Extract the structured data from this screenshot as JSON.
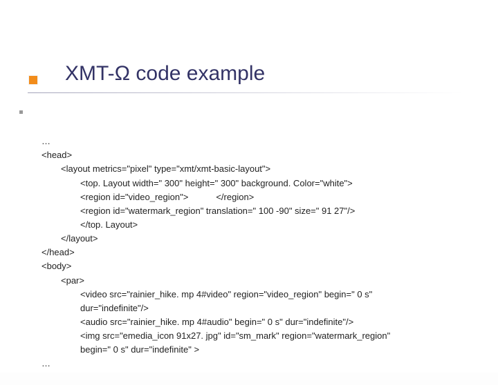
{
  "title": "XMT-Ω code example",
  "code": {
    "l0": "…",
    "l1": "<head>",
    "l2": "<layout metrics=\"pixel\" type=\"xmt/xmt-basic-layout\">",
    "l3": "<top. Layout width=\" 300\" height=\" 300\" background. Color=\"white\">",
    "l4a": "<region id=\"video_region\">",
    "l4b": "</region>",
    "l5": "<region id=\"watermark_region\" translation=\" 100 -90\" size=\" 91 27\"/>",
    "l6": "</top. Layout>",
    "l7": "</layout>",
    "l8": "</head>",
    "l9": "<body>",
    "l10": "<par>",
    "l11": "<video src=\"rainier_hike. mp 4#video\" region=\"video_region\" begin=\" 0 s\"",
    "l12": "dur=\"indefinite\"/>",
    "l13": "<audio src=\"rainier_hike. mp 4#audio\" begin=\" 0 s\" dur=\"indefinite\"/>",
    "l14": "<img src=\"emedia_icon 91x27. jpg\" id=\"sm_mark\" region=\"watermark_region\"",
    "l15": "begin=\" 0 s\" dur=\"indefinite\" >",
    "l16": "…"
  }
}
